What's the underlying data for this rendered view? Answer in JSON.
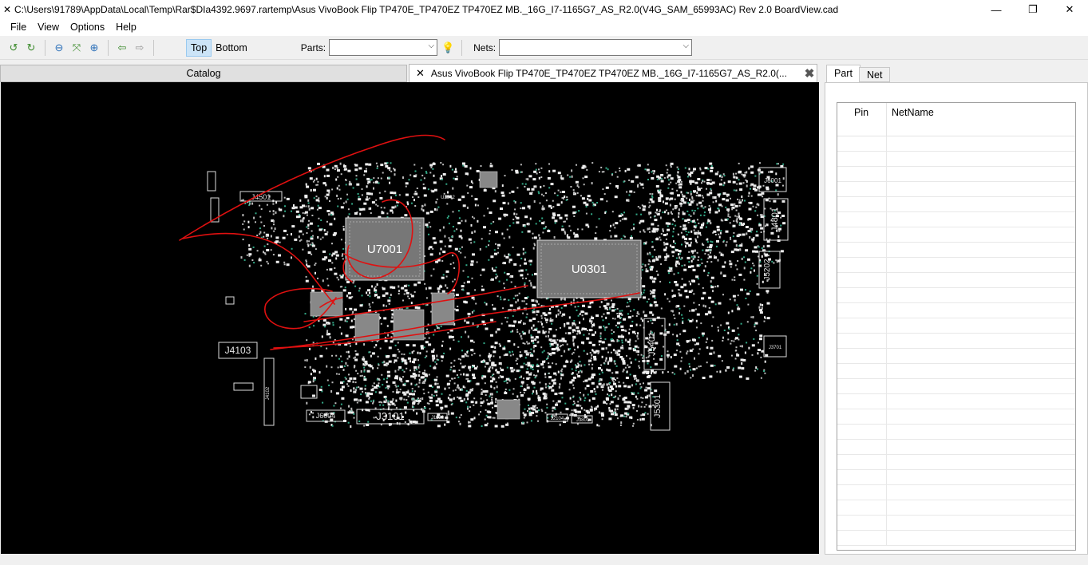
{
  "window": {
    "title": "C:\\Users\\91789\\AppData\\Local\\Temp\\Rar$DIa4392.9697.rartemp\\Asus VivoBook Flip TP470E_TP470EZ TP470EZ MB._16G_I7-1165G7_AS_R2.0(V4G_SAM_65993AC) Rev 2.0 BoardView.cad",
    "minimize": "—",
    "maximize": "❐",
    "close": "✕"
  },
  "menu": {
    "file": "File",
    "view": "View",
    "options": "Options",
    "help": "Help"
  },
  "toolbar": {
    "top_label": "Top",
    "bottom_label": "Bottom",
    "parts_label": "Parts:",
    "parts_value": "",
    "nets_label": "Nets:",
    "nets_value": ""
  },
  "tabs": {
    "catalog": "Catalog",
    "document": "Asus VivoBook Flip TP470E_TP470EZ TP470EZ MB._16G_I7-1165G7_AS_R2.0(..."
  },
  "board": {
    "components": [
      "J4501",
      "U7001",
      "U0301",
      "J4103",
      "J6004",
      "J3101",
      "J6001",
      "J4801",
      "J5202",
      "J5401",
      "J5301",
      "J3701",
      "J4102"
    ],
    "small_labels": [
      "J3801",
      "J2104",
      "J1102",
      "U2502"
    ]
  },
  "right_panel": {
    "tab_part": "Part",
    "tab_net": "Net",
    "col_pin": "Pin",
    "col_netname": "NetName"
  },
  "colors": {
    "canvas": "#000000",
    "annotation": "#e01010",
    "silkscreen": "#d8d8d8",
    "active_tab": "#cce4f7"
  }
}
